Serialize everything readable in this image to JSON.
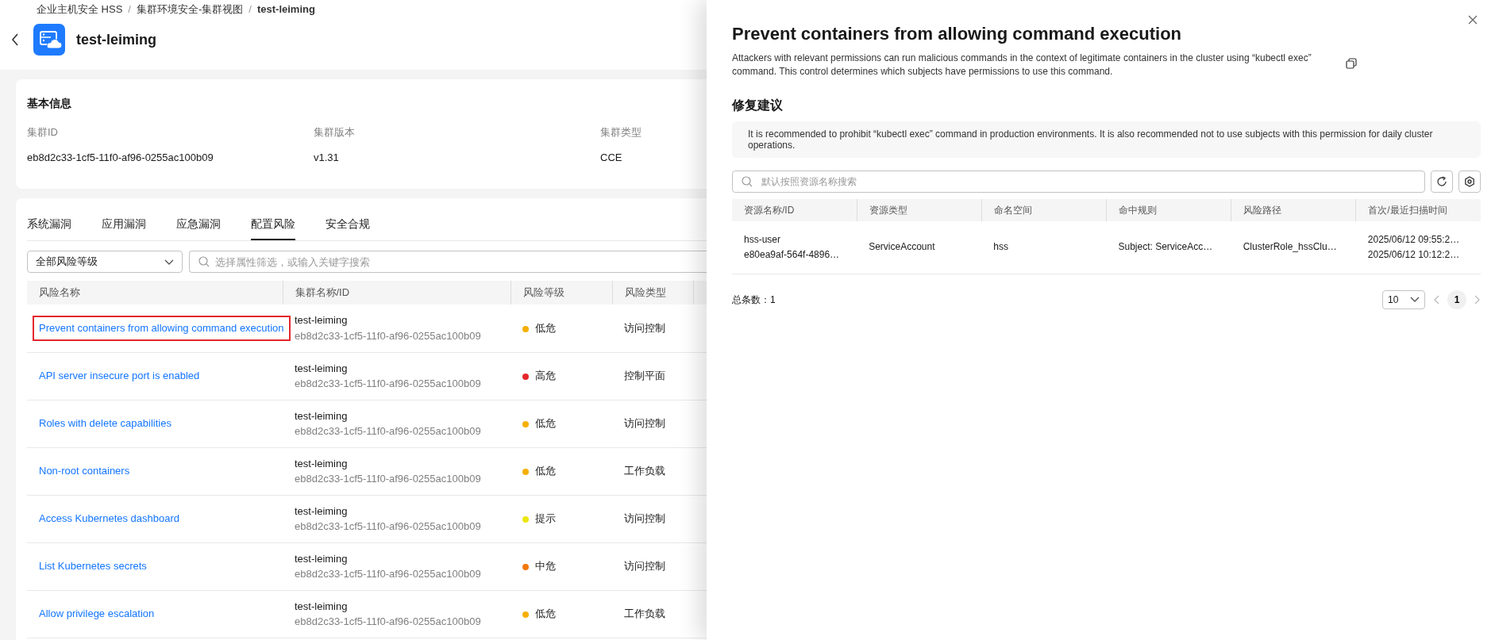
{
  "breadcrumb": {
    "items": [
      "企业主机安全 HSS",
      "集群环境安全-集群视图",
      "test-leiming"
    ],
    "separator": "/"
  },
  "header": {
    "title": "test-leiming"
  },
  "basic_info": {
    "title": "基本信息",
    "fields": [
      {
        "label": "集群ID",
        "value": "eb8d2c33-1cf5-11f0-af96-0255ac100b09"
      },
      {
        "label": "集群版本",
        "value": "v1.31"
      },
      {
        "label": "集群类型",
        "value": "CCE"
      }
    ]
  },
  "tabs": [
    {
      "label": "系统漏洞",
      "selected": false
    },
    {
      "label": "应用漏洞",
      "selected": false
    },
    {
      "label": "应急漏洞",
      "selected": false
    },
    {
      "label": "配置风险",
      "selected": true
    },
    {
      "label": "安全合规",
      "selected": false
    }
  ],
  "filters": {
    "level_select": "全部风险等级",
    "search": {
      "placeholder": "选择属性筛选，或输入关键字搜索"
    }
  },
  "risk_table": {
    "columns": [
      "风险名称",
      "集群名称/ID",
      "风险等级",
      "风险类型"
    ],
    "rows": [
      {
        "name": "Prevent containers from allowing command execution",
        "selected": true,
        "cluster_name": "test-leiming",
        "cluster_id": "eb8d2c33-1cf5-11f0-af96-0255ac100b09",
        "level": "低危",
        "color": "#f5b000",
        "type": "访问控制"
      },
      {
        "name": "API server insecure port is enabled",
        "selected": false,
        "cluster_name": "test-leiming",
        "cluster_id": "eb8d2c33-1cf5-11f0-af96-0255ac100b09",
        "level": "高危",
        "color": "#e5262c",
        "type": "控制平面"
      },
      {
        "name": "Roles with delete capabilities",
        "selected": false,
        "cluster_name": "test-leiming",
        "cluster_id": "eb8d2c33-1cf5-11f0-af96-0255ac100b09",
        "level": "低危",
        "color": "#f5b000",
        "type": "访问控制"
      },
      {
        "name": "Non-root containers",
        "selected": false,
        "cluster_name": "test-leiming",
        "cluster_id": "eb8d2c33-1cf5-11f0-af96-0255ac100b09",
        "level": "低危",
        "color": "#f5b000",
        "type": "工作负载"
      },
      {
        "name": "Access Kubernetes dashboard",
        "selected": false,
        "cluster_name": "test-leiming",
        "cluster_id": "eb8d2c33-1cf5-11f0-af96-0255ac100b09",
        "level": "提示",
        "color": "#ece612",
        "type": "访问控制"
      },
      {
        "name": "List Kubernetes secrets",
        "selected": false,
        "cluster_name": "test-leiming",
        "cluster_id": "eb8d2c33-1cf5-11f0-af96-0255ac100b09",
        "level": "中危",
        "color": "#f5780a",
        "type": "访问控制"
      },
      {
        "name": "Allow privilege escalation",
        "selected": false,
        "cluster_name": "test-leiming",
        "cluster_id": "eb8d2c33-1cf5-11f0-af96-0255ac100b09",
        "level": "低危",
        "color": "#f5b000",
        "type": "工作负载"
      }
    ]
  },
  "drawer": {
    "title": "Prevent containers from allowing command execution",
    "description": "Attackers with relevant permissions can run malicious commands in the context of legitimate containers in the cluster using “kubectl exec” command. This control determines which subjects have permissions to use this command.",
    "section_title": "修复建议",
    "recommendation": "It is recommended to prohibit “kubectl exec” command in production environments. It is also recommended not to use subjects with this permission for daily cluster operations.",
    "search": {
      "placeholder": "默认按照资源名称搜索"
    },
    "table": {
      "columns": [
        "资源名称/ID",
        "资源类型",
        "命名空间",
        "命中规则",
        "风险路径",
        "首次/最近扫描时间"
      ],
      "rows": [
        {
          "name": "hss-user",
          "id": "e80ea9af-564f-4896…",
          "type": "ServiceAccount",
          "namespace": "hss",
          "rule": "Subject: ServiceAcc…",
          "path": "ClusterRole_hssClu…",
          "first_scan": "2025/06/12 09:55:2…",
          "last_scan": "2025/06/12 10:12:2…"
        }
      ]
    },
    "total": "总条数：1",
    "page_size": "10",
    "pages": [
      {
        "label": "1",
        "selected": true
      }
    ]
  }
}
